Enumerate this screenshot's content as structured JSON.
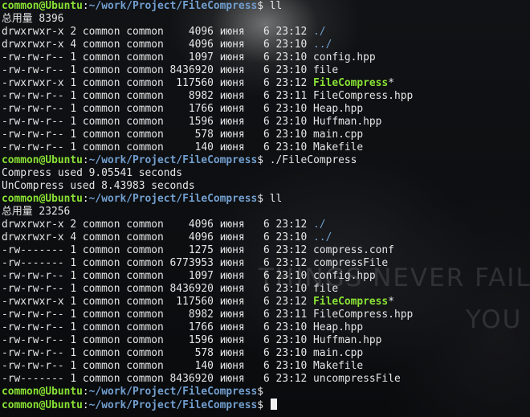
{
  "window": {
    "wallpaper_text_1": "THINGS NEVER FAIL",
    "wallpaper_text_2": "YOU"
  },
  "terminal": {
    "lines": [
      {
        "type": "prompt",
        "user": "common@Ubuntu",
        "sep": ":",
        "path": "~/work/Project/FileCompress",
        "end": "$ ",
        "cmd": "ll"
      },
      {
        "type": "text",
        "text": "总用量 8396"
      },
      {
        "type": "ls",
        "meta": "drwxrwxr-x 2 common common    4096 июня   6 23:12 ",
        "name": "./",
        "style": "dir",
        "suffix": ""
      },
      {
        "type": "ls",
        "meta": "drwxrwxr-x 4 common common    4096 июня   6 23:10 ",
        "name": "../",
        "style": "dir",
        "suffix": ""
      },
      {
        "type": "ls",
        "meta": "-rw-rw-r-- 1 common common    1097 июня   6 23:10 ",
        "name": "config.hpp",
        "style": "",
        "suffix": ""
      },
      {
        "type": "ls",
        "meta": "-rw-rw-r-- 1 common common 8436920 июня   6 23:10 ",
        "name": "file",
        "style": "",
        "suffix": ""
      },
      {
        "type": "ls",
        "meta": "-rwxrwxr-x 1 common common  117560 июня   6 23:12 ",
        "name": "FileCompress",
        "style": "exec",
        "suffix": "*"
      },
      {
        "type": "ls",
        "meta": "-rw-rw-r-- 1 common common    8982 июня   6 23:11 ",
        "name": "FileCompress.hpp",
        "style": "",
        "suffix": ""
      },
      {
        "type": "ls",
        "meta": "-rw-rw-r-- 1 common common    1766 июня   6 23:10 ",
        "name": "Heap.hpp",
        "style": "",
        "suffix": ""
      },
      {
        "type": "ls",
        "meta": "-rw-rw-r-- 1 common common    1596 июня   6 23:10 ",
        "name": "Huffman.hpp",
        "style": "",
        "suffix": ""
      },
      {
        "type": "ls",
        "meta": "-rw-rw-r-- 1 common common     578 июня   6 23:10 ",
        "name": "main.cpp",
        "style": "",
        "suffix": ""
      },
      {
        "type": "ls",
        "meta": "-rw-rw-r-- 1 common common     140 июня   6 23:10 ",
        "name": "Makefile",
        "style": "",
        "suffix": ""
      },
      {
        "type": "prompt",
        "user": "common@Ubuntu",
        "sep": ":",
        "path": "~/work/Project/FileCompress",
        "end": "$ ",
        "cmd": "./FileCompress"
      },
      {
        "type": "text",
        "text": "Compress used 9.05541 seconds"
      },
      {
        "type": "text",
        "text": "UnCompress used 8.43983 seconds"
      },
      {
        "type": "prompt",
        "user": "common@Ubuntu",
        "sep": ":",
        "path": "~/work/Project/FileCompress",
        "end": "$ ",
        "cmd": "ll"
      },
      {
        "type": "text",
        "text": "总用量 23256"
      },
      {
        "type": "ls",
        "meta": "drwxrwxr-x 2 common common    4096 июня   6 23:12 ",
        "name": "./",
        "style": "dir",
        "suffix": ""
      },
      {
        "type": "ls",
        "meta": "drwxrwxr-x 4 common common    4096 июня   6 23:10 ",
        "name": "../",
        "style": "dir",
        "suffix": ""
      },
      {
        "type": "ls",
        "meta": "-rw------- 1 common common    1275 июня   6 23:12 ",
        "name": "compress.conf",
        "style": "",
        "suffix": ""
      },
      {
        "type": "ls",
        "meta": "-rw------- 1 common common 6773953 июня   6 23:12 ",
        "name": "compressFile",
        "style": "",
        "suffix": ""
      },
      {
        "type": "ls",
        "meta": "-rw-rw-r-- 1 common common    1097 июня   6 23:10 ",
        "name": "config.hpp",
        "style": "",
        "suffix": ""
      },
      {
        "type": "ls",
        "meta": "-rw-rw-r-- 1 common common 8436920 июня   6 23:10 ",
        "name": "file",
        "style": "",
        "suffix": ""
      },
      {
        "type": "ls",
        "meta": "-rwxrwxr-x 1 common common  117560 июня   6 23:12 ",
        "name": "FileCompress",
        "style": "exec",
        "suffix": "*"
      },
      {
        "type": "ls",
        "meta": "-rw-rw-r-- 1 common common    8982 июня   6 23:11 ",
        "name": "FileCompress.hpp",
        "style": "",
        "suffix": ""
      },
      {
        "type": "ls",
        "meta": "-rw-rw-r-- 1 common common    1766 июня   6 23:10 ",
        "name": "Heap.hpp",
        "style": "",
        "suffix": ""
      },
      {
        "type": "ls",
        "meta": "-rw-rw-r-- 1 common common    1596 июня   6 23:10 ",
        "name": "Huffman.hpp",
        "style": "",
        "suffix": ""
      },
      {
        "type": "ls",
        "meta": "-rw-rw-r-- 1 common common     578 июня   6 23:10 ",
        "name": "main.cpp",
        "style": "",
        "suffix": ""
      },
      {
        "type": "ls",
        "meta": "-rw-rw-r-- 1 common common     140 июня   6 23:10 ",
        "name": "Makefile",
        "style": "",
        "suffix": ""
      },
      {
        "type": "ls",
        "meta": "-rw------- 1 common common 8436920 июня   6 23:12 ",
        "name": "uncompressFile",
        "style": "",
        "suffix": ""
      },
      {
        "type": "prompt",
        "user": "common@Ubuntu",
        "sep": ":",
        "path": "~/work/Project/FileCompress",
        "end": "$",
        "cmd": ""
      },
      {
        "type": "prompt",
        "user": "common@Ubuntu",
        "sep": ":",
        "path": "~/work/Project/FileCompress",
        "end": "$ ",
        "cmd": "",
        "cursor": true
      }
    ]
  },
  "colors": {
    "user": "#89e234",
    "path": "#729fcf",
    "executable": "#89e234",
    "directory": "#729fcf",
    "text": "#e6e6e6",
    "cursor": "#f0f0f0"
  }
}
